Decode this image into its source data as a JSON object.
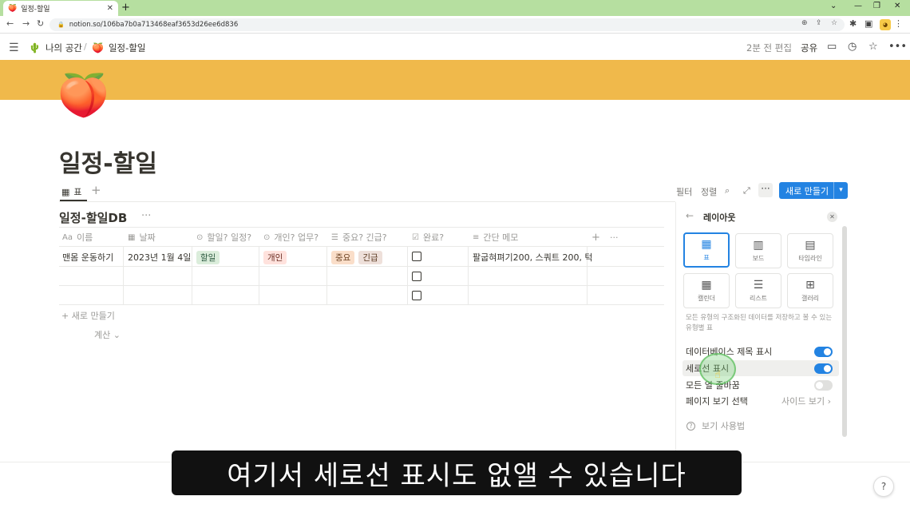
{
  "browser": {
    "tab_title": "일정-할일",
    "tab_favicon": "peach-emoji",
    "url": "notion.so/106ba7b0a713468eaf3653d26ee6d836",
    "colors": {
      "tabstrip": "#b6dfa0"
    }
  },
  "topbar": {
    "breadcrumb": [
      {
        "icon": "🌵",
        "label": "나의 공간"
      },
      {
        "icon": "🍑",
        "label": "일정-할일"
      }
    ],
    "edited": "2분 전 편집",
    "share": "공유"
  },
  "page": {
    "icon": "🍑",
    "title": "일정-할일",
    "cover_color": "#f0b94b"
  },
  "view": {
    "tab_label": "표",
    "filter": "필터",
    "sort": "정렬",
    "new_button": "새로 만들기"
  },
  "database": {
    "title": "일정-할일DB",
    "columns": [
      {
        "icon": "Aa",
        "label": "이름"
      },
      {
        "icon": "calendar-icon",
        "label": "날짜"
      },
      {
        "icon": "select-icon",
        "label": "할일? 일정?"
      },
      {
        "icon": "select-icon",
        "label": "개인? 업무?"
      },
      {
        "icon": "multiselect-icon",
        "label": "중요? 긴급?"
      },
      {
        "icon": "checkbox-icon",
        "label": "완료?"
      },
      {
        "icon": "text-icon",
        "label": "간단 메모"
      }
    ],
    "rows": [
      {
        "name": "맨몸 운동하기",
        "date": "2023년 1월 4일",
        "type": "할일",
        "scope": "개인",
        "priority": [
          "중요",
          "긴급"
        ],
        "done": false,
        "memo": "팔굽혀펴기200, 스쿼트 200, 턱"
      },
      {
        "name": "",
        "date": "",
        "type": "",
        "scope": "",
        "priority": [],
        "done": false,
        "memo": ""
      },
      {
        "name": "",
        "date": "",
        "type": "",
        "scope": "",
        "priority": [],
        "done": false,
        "memo": ""
      }
    ],
    "add_row": "새로 만들기",
    "calc": "계산"
  },
  "layout_panel": {
    "title": "레이아웃",
    "options": [
      {
        "icon": "table-icon",
        "label": "표",
        "selected": true
      },
      {
        "icon": "board-icon",
        "label": "보드",
        "selected": false
      },
      {
        "icon": "timeline-icon",
        "label": "타임라인",
        "selected": false
      },
      {
        "icon": "calendar-icon",
        "label": "캘린더",
        "selected": false
      },
      {
        "icon": "list-icon",
        "label": "리스트",
        "selected": false
      },
      {
        "icon": "gallery-icon",
        "label": "갤러리",
        "selected": false
      }
    ],
    "description": "모든 유형의 구조화된 데이터를 저장하고 볼 수 있는 유형별 표",
    "settings": [
      {
        "label": "데이터베이스 제목 표시",
        "toggle": true
      },
      {
        "label": "세로선 표시",
        "toggle": true
      },
      {
        "label": "모든 열 줄바꿈",
        "toggle": false
      },
      {
        "label": "페이지 보기 선택",
        "value": "사이드 보기"
      }
    ],
    "help": "보기 사용법",
    "accent": "#2383e2"
  },
  "subtitle": "여기서 세로선 표시도 없앨 수 있습니다",
  "help_button": "?"
}
